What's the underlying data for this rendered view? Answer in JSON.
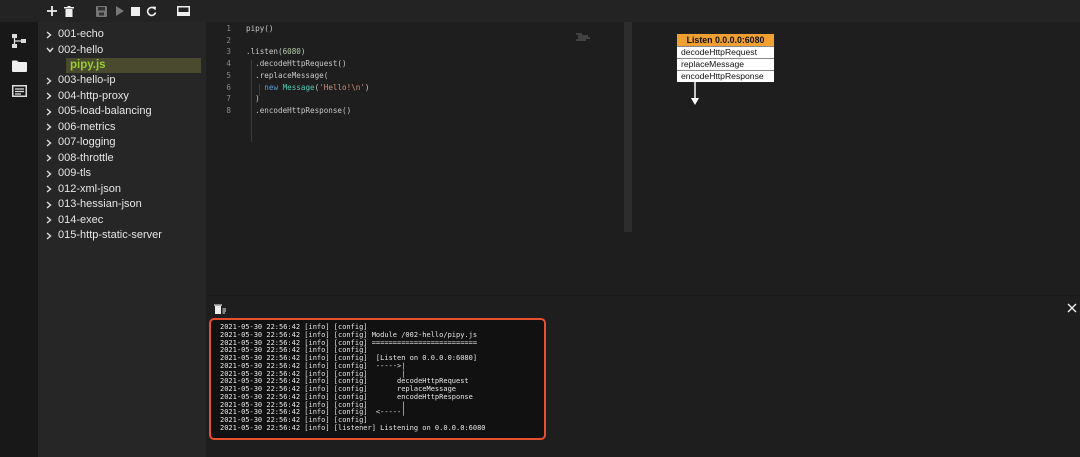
{
  "toolbar": {
    "icons": [
      "plus-icon",
      "trash-icon",
      "save-icon",
      "run-icon",
      "stop-icon",
      "reload-icon",
      "panel-icon"
    ]
  },
  "rail": {
    "icons": [
      "pipeline-icon",
      "folder-icon",
      "console-icon"
    ]
  },
  "tree": {
    "items": [
      {
        "label": "001-echo",
        "type": "folder",
        "expanded": false
      },
      {
        "label": "002-hello",
        "type": "folder",
        "expanded": true
      },
      {
        "label": "pipy.js",
        "type": "file",
        "selected": true
      },
      {
        "label": "003-hello-ip",
        "type": "folder",
        "expanded": false
      },
      {
        "label": "004-http-proxy",
        "type": "folder",
        "expanded": false
      },
      {
        "label": "005-load-balancing",
        "type": "folder",
        "expanded": false
      },
      {
        "label": "006-metrics",
        "type": "folder",
        "expanded": false
      },
      {
        "label": "007-logging",
        "type": "folder",
        "expanded": false
      },
      {
        "label": "008-throttle",
        "type": "folder",
        "expanded": false
      },
      {
        "label": "009-tls",
        "type": "folder",
        "expanded": false
      },
      {
        "label": "012-xml-json",
        "type": "folder",
        "expanded": false
      },
      {
        "label": "013-hessian-json",
        "type": "folder",
        "expanded": false
      },
      {
        "label": "014-exec",
        "type": "folder",
        "expanded": false
      },
      {
        "label": "015-http-static-server",
        "type": "folder",
        "expanded": false
      }
    ]
  },
  "editor": {
    "lines": [
      {
        "num": "1",
        "tokens": [
          [
            "fn",
            "pipy()"
          ]
        ]
      },
      {
        "num": "2",
        "tokens": []
      },
      {
        "num": "3",
        "tokens": [
          [
            "fn",
            ".listen("
          ],
          [
            "num",
            "6080"
          ],
          [
            "fn",
            ")"
          ]
        ]
      },
      {
        "num": "4",
        "tokens": [
          [
            "fn",
            "  .decodeHttpRequest()"
          ]
        ]
      },
      {
        "num": "5",
        "tokens": [
          [
            "fn",
            "  .replaceMessage("
          ]
        ]
      },
      {
        "num": "6",
        "tokens": [
          [
            "fn",
            "    "
          ],
          [
            "kw",
            "new"
          ],
          [
            "fn",
            " "
          ],
          [
            "cls",
            "Message"
          ],
          [
            "fn",
            "("
          ],
          [
            "str",
            "'Hello!\\n'"
          ],
          [
            "fn",
            ")"
          ]
        ]
      },
      {
        "num": "7",
        "tokens": [
          [
            "fn",
            "  )"
          ]
        ]
      },
      {
        "num": "8",
        "tokens": [
          [
            "fn",
            "  .encodeHttpResponse()"
          ]
        ]
      }
    ]
  },
  "diagram": {
    "header": "Listen 0.0.0.0:6080",
    "steps": [
      "decodeHttpRequest",
      "replaceMessage",
      "encodeHttpResponse"
    ]
  },
  "console": {
    "clear_icon": "clear-log-icon",
    "close_icon": "close-icon",
    "lines": [
      "2021-05-30 22:56:42 [info] [config]",
      "2021-05-30 22:56:42 [info] [config] Module /002-hello/pipy.js",
      "2021-05-30 22:56:42 [info] [config] =========================",
      "2021-05-30 22:56:42 [info] [config]",
      "2021-05-30 22:56:42 [info] [config]  [Listen on 0.0.0.0:6080]",
      "2021-05-30 22:56:42 [info] [config]  ----->|",
      "2021-05-30 22:56:42 [info] [config]        |",
      "2021-05-30 22:56:42 [info] [config]       decodeHttpRequest",
      "2021-05-30 22:56:42 [info] [config]       replaceMessage",
      "2021-05-30 22:56:42 [info] [config]       encodeHttpResponse",
      "2021-05-30 22:56:42 [info] [config]        |",
      "2021-05-30 22:56:42 [info] [config]  <-----|",
      "2021-05-30 22:56:42 [info] [config]",
      "2021-05-30 22:56:42 [info] [listener] Listening on 0.0.0.0:6080"
    ]
  }
}
